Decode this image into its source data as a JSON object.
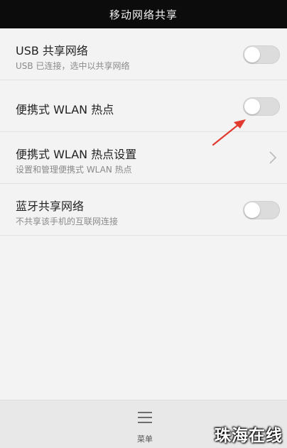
{
  "header": {
    "title": "移动网络共享"
  },
  "rows": [
    {
      "title": "USB 共享网络",
      "subtitle": "USB 已连接，选中以共享网络",
      "control": "toggle",
      "state": "off"
    },
    {
      "title": "便携式 WLAN 热点",
      "subtitle": "",
      "control": "toggle",
      "state": "off"
    },
    {
      "title": "便携式 WLAN 热点设置",
      "subtitle": "设置和管理便携式 WLAN 热点",
      "control": "chevron"
    },
    {
      "title": "蓝牙共享网络",
      "subtitle": "不共享该手机的互联网连接",
      "control": "toggle",
      "state": "off"
    }
  ],
  "bottom": {
    "menu_label": "菜单",
    "menu_icon": "hamburger-menu-icon"
  },
  "annotation": {
    "color": "#e23a2f",
    "icon": "red-arrow-annotation"
  },
  "watermark": {
    "text": "珠海在线"
  },
  "colors": {
    "header_bg": "#0c0c0c",
    "background": "#f3f3f3",
    "toggle_off": "#dcdcdc"
  }
}
